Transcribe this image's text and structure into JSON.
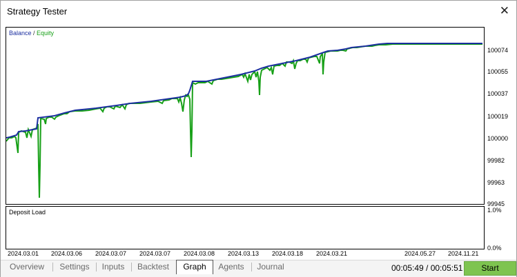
{
  "window": {
    "title": "Strategy Tester"
  },
  "chart": {
    "legend": {
      "balance": "Balance",
      "separator": " / ",
      "equity": "Equity"
    },
    "y_ticks": [
      "100074",
      "100055",
      "100037",
      "100019",
      "100000",
      "99982",
      "99963",
      "99945"
    ],
    "x_ticks": [
      "2024.03.01",
      "2024.03.06",
      "2024.03.07",
      "2024.03.07",
      "2024.03.08",
      "2024.03.13",
      "2024.03.18",
      "2024.03.21",
      "2024.05.27",
      "2024.11.21"
    ]
  },
  "deposit": {
    "label": "Deposit Load",
    "y_ticks": [
      "1.0%",
      "0.0%"
    ]
  },
  "tabs": [
    "Overview",
    "Settings",
    "Inputs",
    "Backtest",
    "Graph",
    "Agents",
    "Journal"
  ],
  "active_tab": "Graph",
  "status": {
    "time": "00:05:49 / 00:05:51"
  },
  "actions": {
    "start": "Start"
  },
  "colors": {
    "balance": "#1c2fa0",
    "equity": "#17a017",
    "start_button": "#7ec450"
  }
}
